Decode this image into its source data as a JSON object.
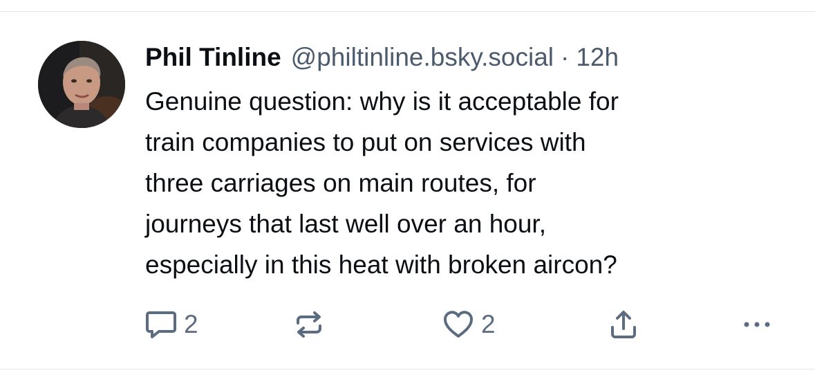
{
  "post": {
    "author": {
      "display_name": "Phil Tinline",
      "handle": "@philtinline.bsky.social"
    },
    "separator": "·",
    "time": "12h",
    "text_lines": [
      "Genuine question: why is it acceptable for",
      "train companies to put on services with",
      "three carriages on main routes, for",
      "journeys that last well over an hour,",
      "especially in this heat with broken aircon?"
    ],
    "actions": {
      "reply_count": "2",
      "like_count": "2"
    }
  },
  "icons": {
    "reply": "speech-bubble-icon",
    "repost": "repost-icon",
    "like": "heart-icon",
    "share": "share-icon",
    "more": "ellipsis-icon"
  },
  "colors": {
    "text": "#0b0f14",
    "secondary": "#4b5a6d",
    "icon": "#5b6b80",
    "divider": "#e3e6ea"
  }
}
